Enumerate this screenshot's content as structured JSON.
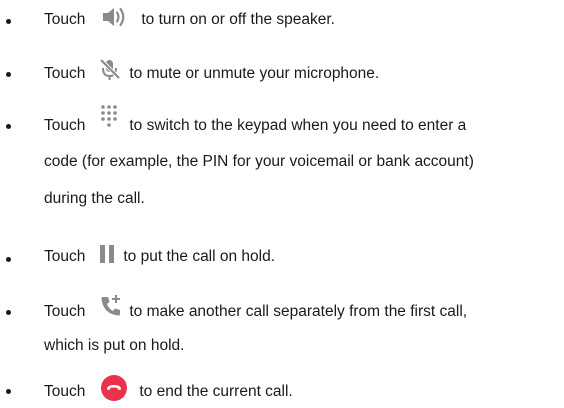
{
  "items": [
    {
      "lead": "Touch",
      "icon": "speaker-icon",
      "lines": [
        "to turn on or off the speaker."
      ]
    },
    {
      "lead": "Touch",
      "icon": "mute-microphone-icon",
      "lines": [
        "to mute or unmute your microphone."
      ]
    },
    {
      "lead": "Touch",
      "icon": "keypad-icon",
      "lines": [
        "to switch to the keypad when you need to enter a",
        "code (for example, the PIN for your voicemail or bank account)",
        "during the call."
      ]
    },
    {
      "lead": "Touch",
      "icon": "pause-icon",
      "lines": [
        "to put the call on hold."
      ]
    },
    {
      "lead": "Touch",
      "icon": "add-call-icon",
      "lines": [
        "to make another call separately from the first call,",
        "which is put on hold."
      ]
    },
    {
      "lead": "Touch",
      "icon": "end-call-icon",
      "lines": [
        "to end the current call."
      ]
    }
  ],
  "colors": {
    "text": "#1a1a1a",
    "icon_gray": "#8a8a8a",
    "end_call_red": "#e8334a"
  }
}
